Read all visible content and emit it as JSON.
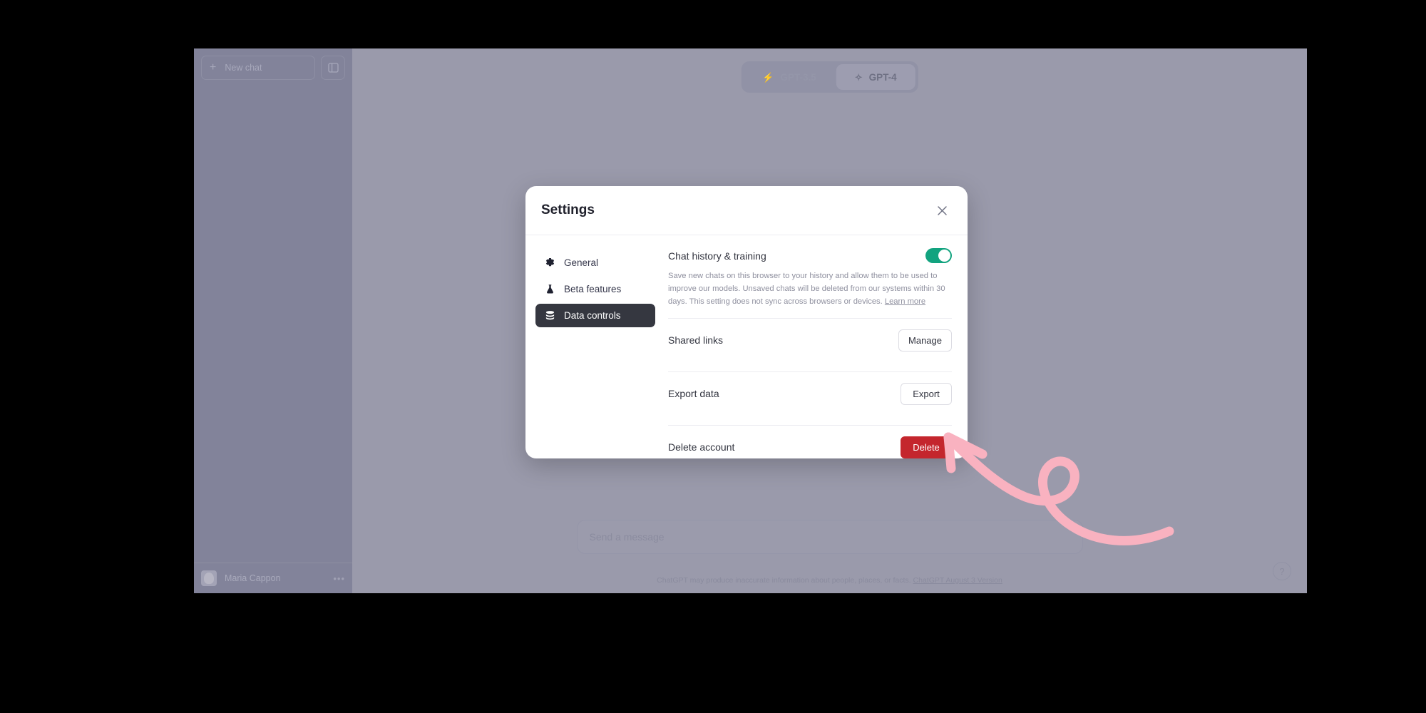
{
  "app": {
    "sidebar": {
      "new_chat_label": "New chat",
      "new_chat_icon": "plus-icon",
      "panel_toggle_icon": "sidebar-panel-icon",
      "user_name": "Maria Cappon",
      "user_menu_icon": "ellipsis-icon"
    },
    "main": {
      "models": [
        {
          "label": "GPT-3.5",
          "icon": "lightning-bolt-icon",
          "active": false
        },
        {
          "label": "GPT-4",
          "icon": "sparkles-icon",
          "active": true
        }
      ],
      "composer_placeholder": "Send a message",
      "footer_text": "ChatGPT may produce inaccurate information about people, places, or facts. ",
      "footer_link": "ChatGPT August 3 Version",
      "help_label": "?"
    }
  },
  "modal": {
    "title": "Settings",
    "close_icon": "close-icon",
    "nav": [
      {
        "label": "General",
        "icon": "gear-icon",
        "active": false
      },
      {
        "label": "Beta features",
        "icon": "flask-icon",
        "active": false
      },
      {
        "label": "Data controls",
        "icon": "database-icon",
        "active": true
      }
    ],
    "chat_history": {
      "title": "Chat history & training",
      "description": "Save new chats on this browser to your history and allow them to be used to improve our models. Unsaved chats will be deleted from our systems within 30 days. This setting does not sync across browsers or devices. ",
      "learn_more": "Learn more",
      "toggle_on": true
    },
    "rows": [
      {
        "label": "Shared links",
        "button": "Manage",
        "style": "default"
      },
      {
        "label": "Export data",
        "button": "Export",
        "style": "default"
      },
      {
        "label": "Delete account",
        "button": "Delete",
        "style": "danger"
      }
    ]
  },
  "annotation": {
    "arrow_icon": "curly-arrow-annotation",
    "color": "#f9b2c0"
  },
  "colors": {
    "toggle_on": "#12a37f",
    "danger": "#c4262d",
    "nav_active_bg": "#353740",
    "annotation_pink": "#f9b2c0"
  }
}
